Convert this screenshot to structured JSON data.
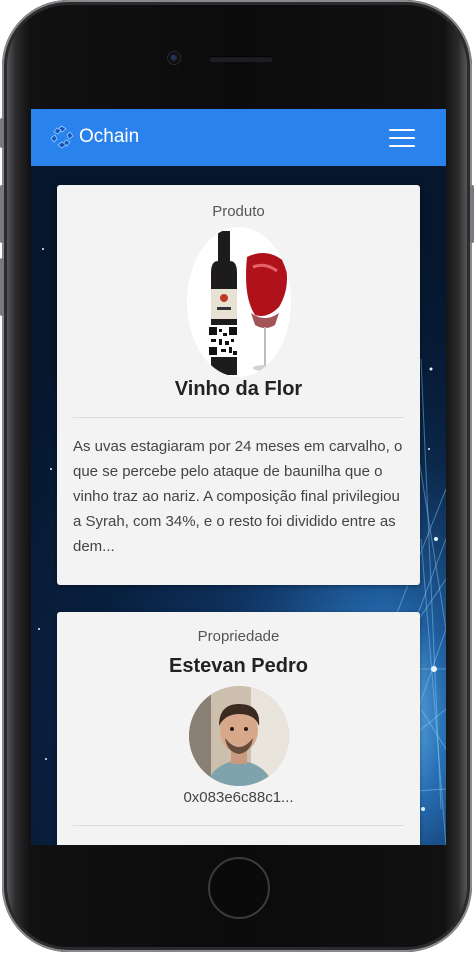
{
  "app": {
    "brand": "Ochain"
  },
  "icons": {
    "logo": "ochain-logo-icon",
    "menu": "hamburger-menu-icon"
  },
  "colors": {
    "navbar": "#2a82ec",
    "card": "#f3f3f3"
  },
  "product_card": {
    "label": "Produto",
    "name": "Vinho da Flor",
    "description": "As uvas estagiaram por 24 meses em carvalho, o que se percebe pelo ataque de baunilha que o vinho traz ao nariz. A composição final privilegiou a Syrah, com 34%, e o resto foi dividido entre as dem..."
  },
  "property_card": {
    "label": "Propriedade",
    "owner_name": "Estevan Pedro",
    "address": "0x083e6c88c1..."
  }
}
